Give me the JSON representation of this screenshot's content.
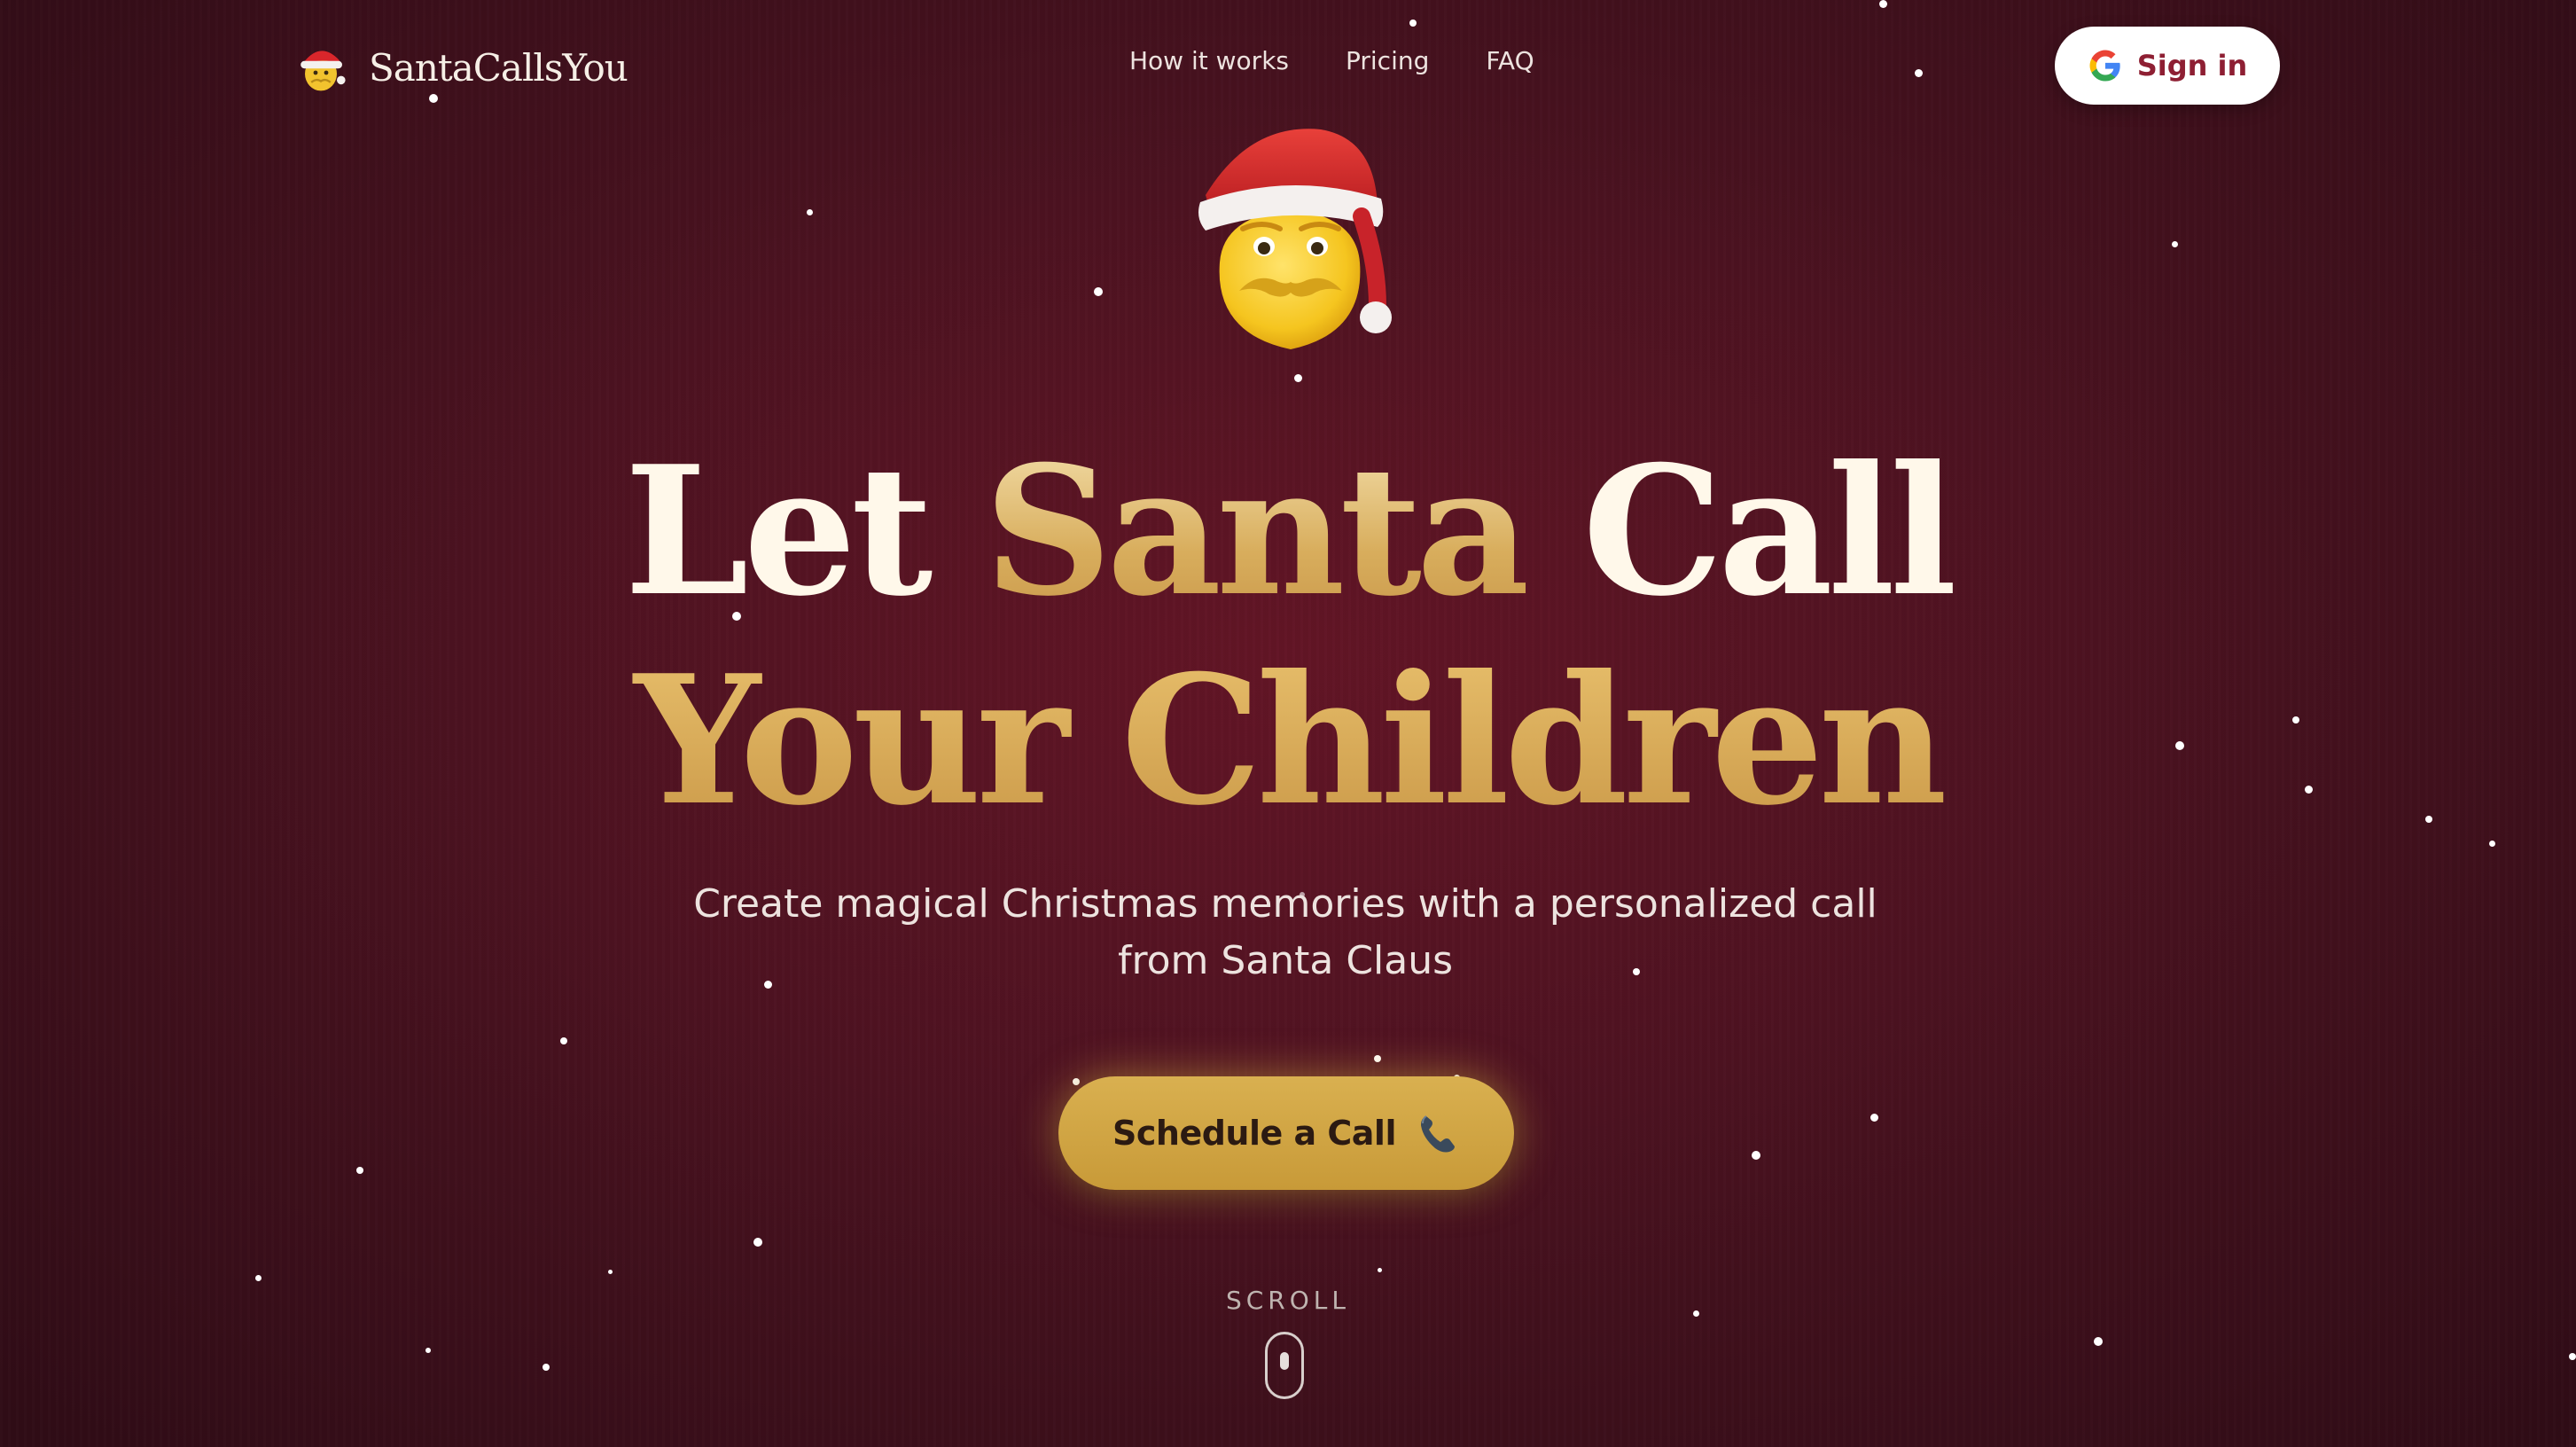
{
  "brand": {
    "name": "SantaCallsYou",
    "logo_icon": "santa-face-icon"
  },
  "nav": {
    "links": [
      {
        "label": "How it works"
      },
      {
        "label": "Pricing"
      },
      {
        "label": "FAQ"
      }
    ],
    "signin_label": "Sign in",
    "signin_icon": "google-g-icon"
  },
  "hero": {
    "icon": "santa-face-icon",
    "headline": {
      "line1_a": "Let ",
      "line1_b": "Santa",
      "line1_c": " Call",
      "line2": "Your Children"
    },
    "subtitle_line1": "Create magical Christmas memories with a personalized call",
    "subtitle_line2": "from Santa Claus",
    "cta_label": "Schedule a Call",
    "cta_icon": "telephone-receiver-icon"
  },
  "scroll_hint": {
    "label": "SCROLL",
    "icon": "mouse-scroll-icon"
  },
  "colors": {
    "background": "#4a1220",
    "gold": "#d4a44f",
    "cream": "#fff8ea",
    "signin_text": "#8e1f33"
  }
}
